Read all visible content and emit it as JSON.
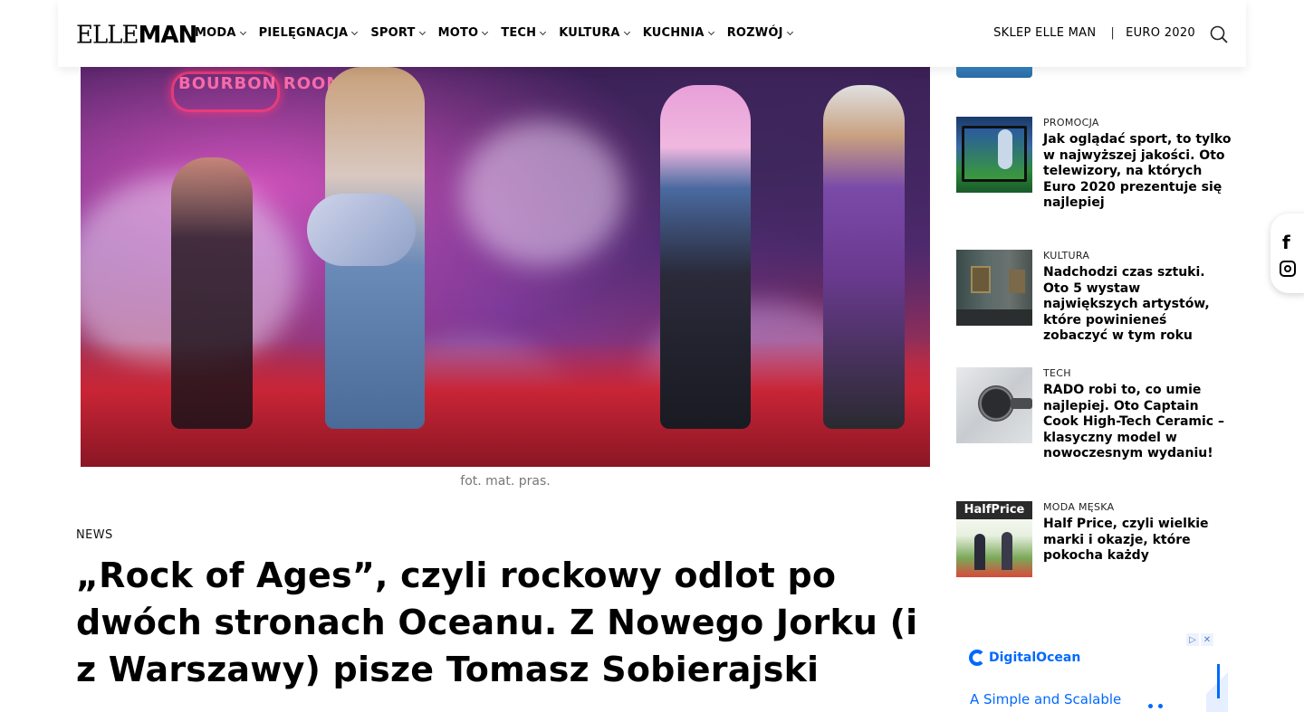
{
  "header": {
    "logo_elle": "ELLE",
    "logo_man": "MAN",
    "nav": [
      {
        "label": "MODA"
      },
      {
        "label": "PIELĘGNACJA"
      },
      {
        "label": "SPORT"
      },
      {
        "label": "MOTO"
      },
      {
        "label": "TECH"
      },
      {
        "label": "KULTURA"
      },
      {
        "label": "KUCHNIA"
      },
      {
        "label": "ROZWÓJ"
      }
    ],
    "shop_link": "SKLEP ELLE MAN",
    "separator": "|",
    "euro_link": "EURO 2020",
    "search_icon": "search-icon"
  },
  "hero": {
    "neon_sign": "BOURBON ROOM",
    "caption": "fot. mat. pras."
  },
  "article": {
    "category": "NEWS",
    "title": "„Rock of Ages”, czyli rockowy odlot po dwóch stronach Oceanu. Z Nowego Jorku (i z Warszawy) pisze Tomasz Sobierajski"
  },
  "sidebar": {
    "items": [
      {
        "category": "PROMOCJA",
        "title": "Jak oglądać sport, to tylko w najwyższej jakości. Oto telewizory, na których Euro 2020 prezentuje się najlepiej"
      },
      {
        "category": "KULTURA",
        "title": "Nadchodzi czas sztuki. Oto 5 wystaw największych artystów, które powinieneś zobaczyć w tym roku"
      },
      {
        "category": "TECH",
        "title": "RADO robi to, co umie najlepiej. Oto Captain Cook High-Tech Ceramic – klasyczny model w nowoczesnym wydaniu!"
      },
      {
        "category": "MODA MĘSKA",
        "title": "Half Price, czyli wielkie marki i okazje, które pokocha każdy",
        "thumb_text": "HalfPrice"
      }
    ]
  },
  "social": {
    "facebook": "f"
  },
  "ad": {
    "brand": "DigitalOcean",
    "tagline": "A Simple and Scalable",
    "adchoice_play": "▷",
    "adchoice_close": "✕"
  },
  "colors": {
    "accent_ad": "#0069ff",
    "text": "#000000",
    "caption": "#777777"
  }
}
